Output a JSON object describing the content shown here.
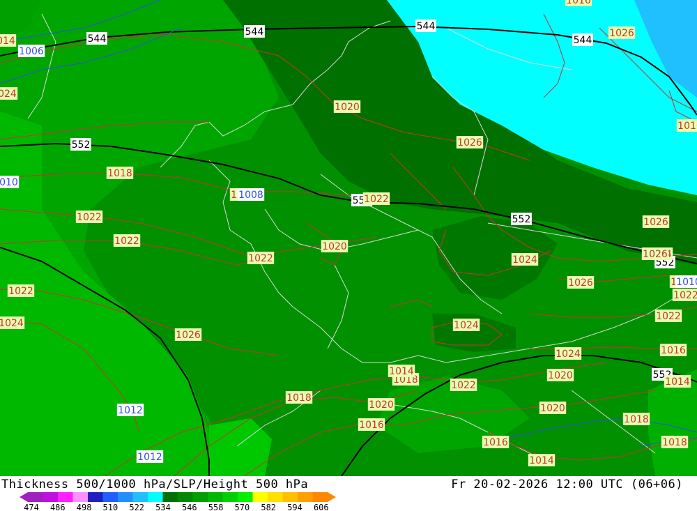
{
  "header": {
    "title": "Thickness 500/1000 hPa/SLP/Height 500 hPa",
    "timestamp": "Fr 20-02-2026 12:00 UTC (06+06)"
  },
  "legend": {
    "ticks": [
      "474",
      "486",
      "498",
      "510",
      "522",
      "534",
      "546",
      "558",
      "570",
      "582",
      "594",
      "606"
    ],
    "colors": [
      "#a020c0",
      "#c010e0",
      "#ff20ff",
      "#ff90ff",
      "#2020c0",
      "#2060ff",
      "#2090ff",
      "#20c0ff",
      "#00ffff",
      "#007000",
      "#008800",
      "#00a000",
      "#00b800",
      "#00d000",
      "#00f000",
      "#ffff00",
      "#ffe000",
      "#ffc000",
      "#ffa000",
      "#ff8800"
    ]
  },
  "map": {
    "colors": {
      "cyan": "#00ffff",
      "blue": "#20c0ff",
      "dark_green": "#007000",
      "green": "#009000",
      "mid_green": "#00a500",
      "light_green": "#00b800",
      "bright_green": "#00d000",
      "slp_contour": "#c03030",
      "height_contour": "#000000",
      "border": "#d0d0d0"
    },
    "height_labels": [
      "544",
      "544",
      "544",
      "544",
      "552",
      "552",
      "552",
      "552",
      "552"
    ],
    "slp_labels": [
      "1026",
      "1006",
      "1018",
      "1020",
      "1022",
      "1024",
      "1026",
      "1020",
      "1026",
      "1020",
      "1022",
      "1022",
      "1022",
      "1022",
      "1024",
      "1024",
      "1026",
      "1024",
      "1026",
      "1024",
      "1022",
      "1022",
      "1024",
      "1020",
      "1018",
      "1018",
      "1020",
      "1016",
      "1014",
      "1022",
      "1020",
      "1018",
      "1016",
      "1014",
      "1018",
      "1016",
      "1012",
      "1012",
      "1014",
      "1010",
      "1016",
      "1024",
      "1016",
      "1014",
      "1010",
      "1008",
      "1026"
    ]
  }
}
